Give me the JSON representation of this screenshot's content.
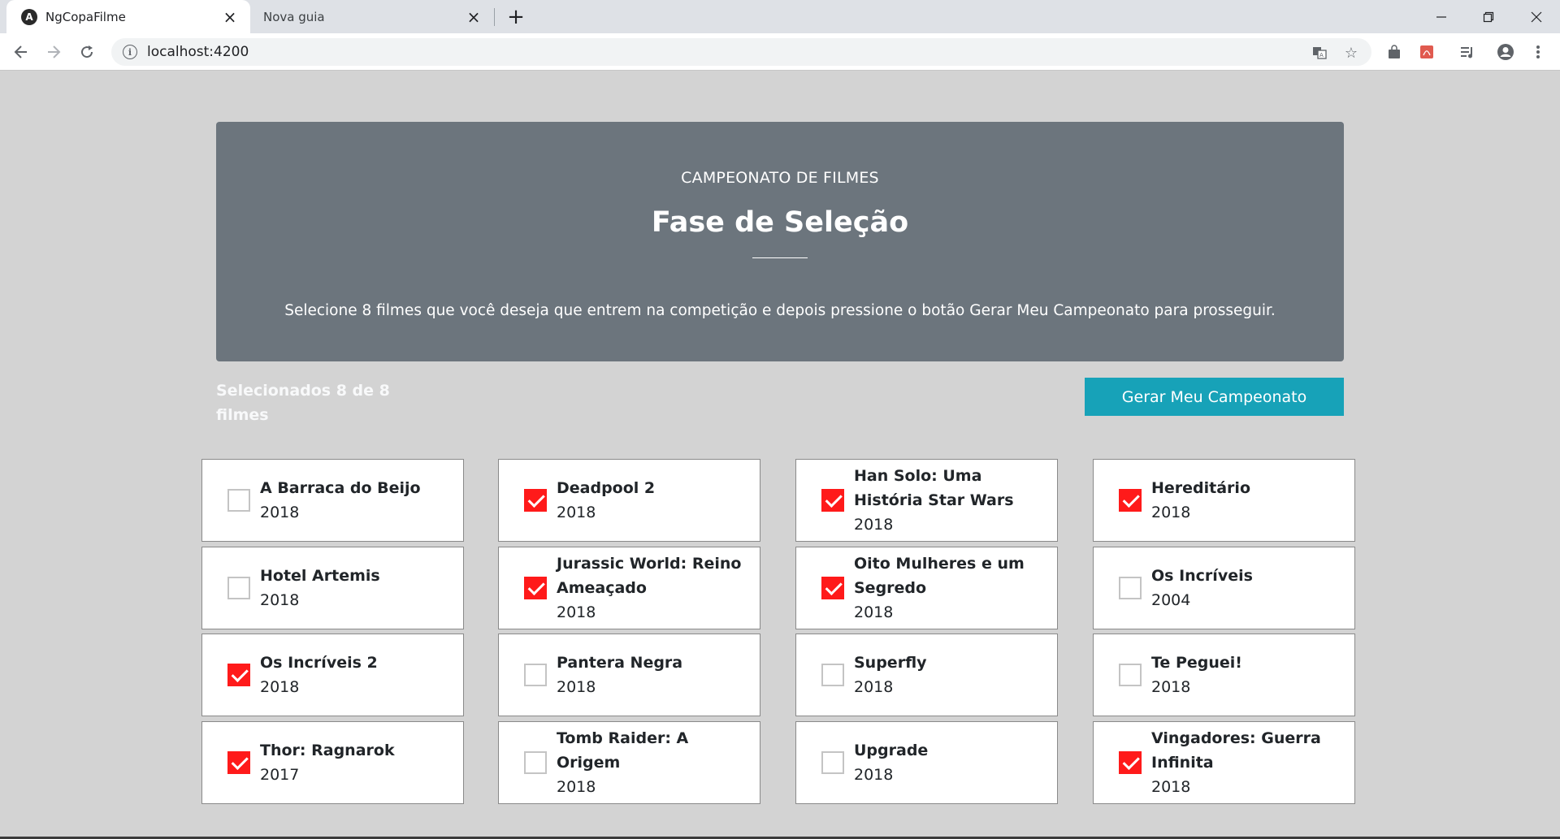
{
  "browser": {
    "tabs": [
      {
        "title": "NgCopaFilme",
        "favicon": "angular-icon"
      },
      {
        "title": "Nova guia"
      }
    ],
    "url": "localhost:4200"
  },
  "hero": {
    "eyebrow": "CAMPEONATO DE FILMES",
    "title": "Fase de Seleção",
    "description": "Selecione 8 filmes que você deseja que entrem na competição e depois pressione o botão Gerar Meu Campeonato para prosseguir."
  },
  "selection": {
    "counter_text": "Selecionados 8 de 8 filmes",
    "generate_label": "Gerar Meu Campeonato"
  },
  "colors": {
    "hero_bg": "#6c757d",
    "button_bg": "#17a2b8",
    "checkbox_checked": "#ff1a1a",
    "page_bg": "#d3d3d3"
  },
  "movies": [
    {
      "title": "A Barraca do Beijo",
      "year": "2018",
      "selected": false
    },
    {
      "title": "Deadpool 2",
      "year": "2018",
      "selected": true
    },
    {
      "title": "Han Solo: Uma História Star Wars",
      "year": "2018",
      "selected": true
    },
    {
      "title": "Hereditário",
      "year": "2018",
      "selected": true
    },
    {
      "title": "Hotel Artemis",
      "year": "2018",
      "selected": false
    },
    {
      "title": "Jurassic World: Reino Ameaçado",
      "year": "2018",
      "selected": true
    },
    {
      "title": "Oito Mulheres e um Segredo",
      "year": "2018",
      "selected": true
    },
    {
      "title": "Os Incríveis",
      "year": "2004",
      "selected": false
    },
    {
      "title": "Os Incríveis 2",
      "year": "2018",
      "selected": true
    },
    {
      "title": "Pantera Negra",
      "year": "2018",
      "selected": false
    },
    {
      "title": "Superfly",
      "year": "2018",
      "selected": false
    },
    {
      "title": "Te Peguei!",
      "year": "2018",
      "selected": false
    },
    {
      "title": "Thor: Ragnarok",
      "year": "2017",
      "selected": true
    },
    {
      "title": "Tomb Raider: A Origem",
      "year": "2018",
      "selected": false
    },
    {
      "title": "Upgrade",
      "year": "2018",
      "selected": false
    },
    {
      "title": "Vingadores: Guerra Infinita",
      "year": "2018",
      "selected": true
    }
  ]
}
